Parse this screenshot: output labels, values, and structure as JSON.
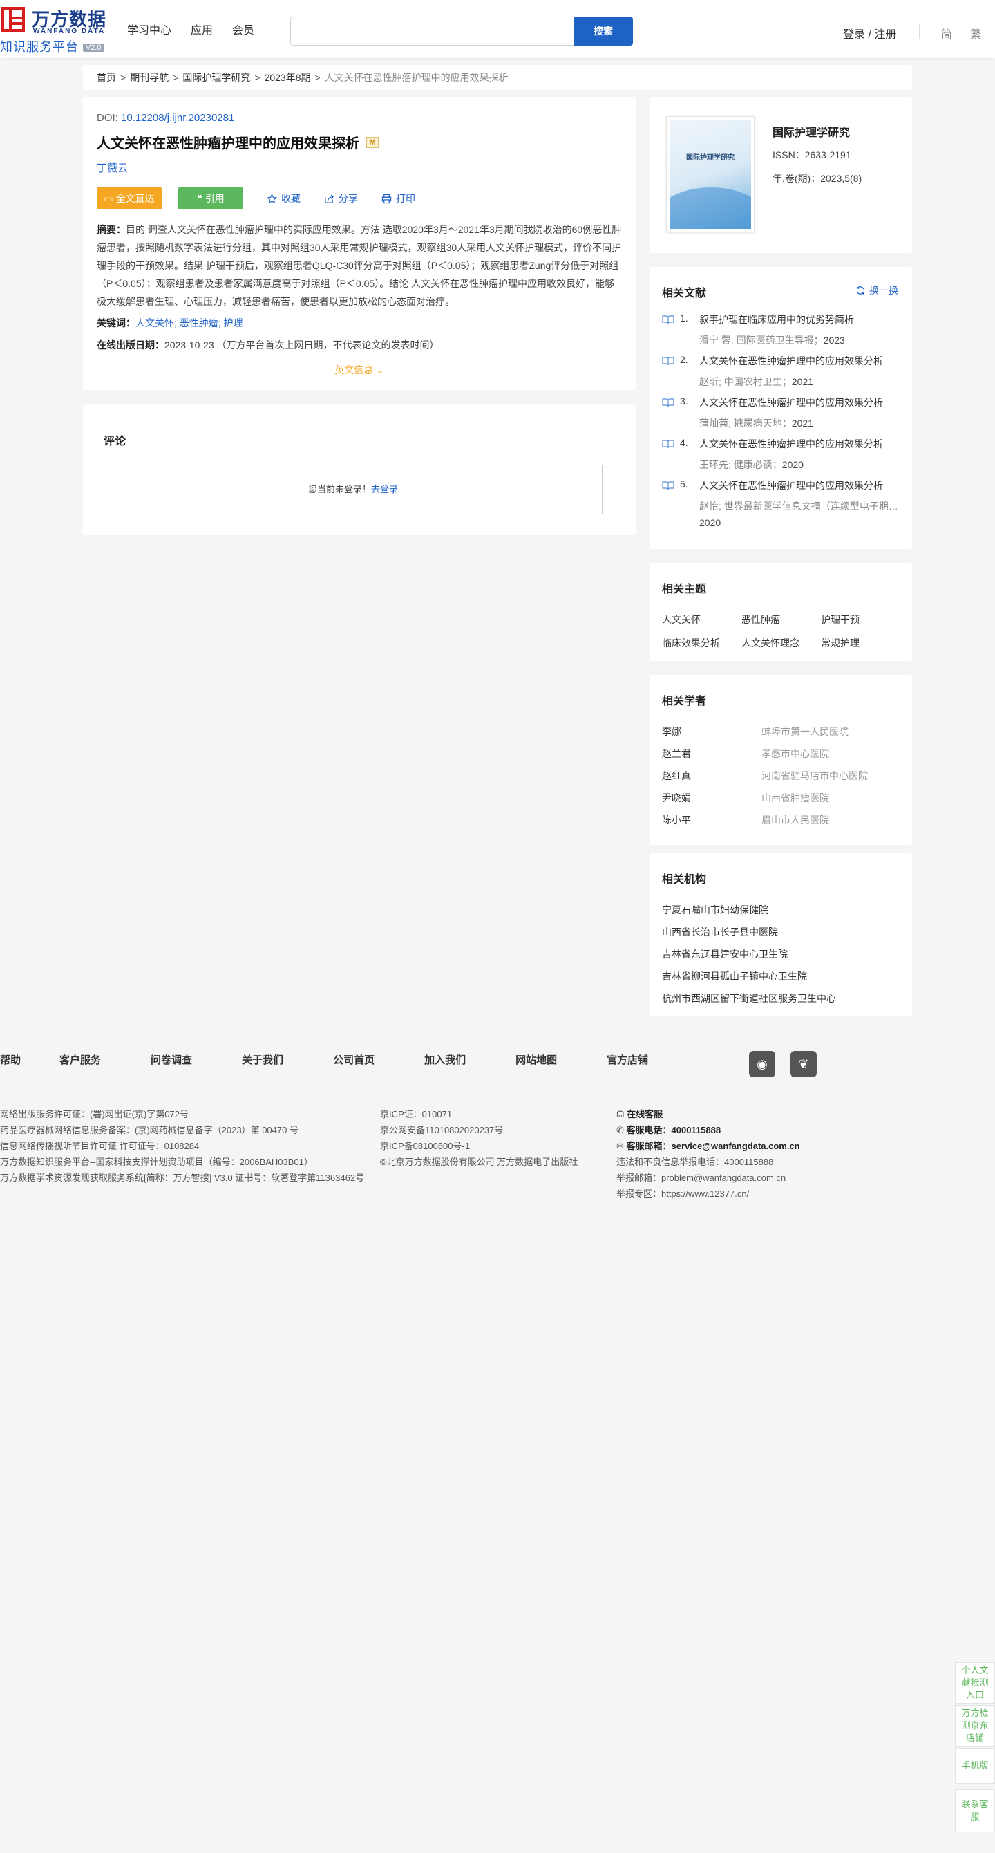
{
  "header": {
    "logo_cn": "万方数据",
    "logo_en": "WANFANG DATA",
    "logo_sub": "知识服务平台",
    "logo_version": "V2.0",
    "nav": [
      "学习中心",
      "应用",
      "会员"
    ],
    "search_placeholder": "",
    "search_button": "搜索",
    "login": "登录 / 注册",
    "lang_simplified": "简",
    "lang_traditional": "繁"
  },
  "breadcrumb": {
    "home": "首页",
    "journals": "期刊导航",
    "journal": "国际护理学研究",
    "issue": "2023年8期",
    "current": "人文关怀在恶性肿瘤护理中的应用效果探析"
  },
  "article": {
    "doi_label": "DOI:",
    "doi": "10.12208/j.ijnr.20230281",
    "title": "人文关怀在恶性肿瘤护理中的应用效果探析",
    "badge": "M",
    "author": "丁薇云",
    "btn_full": "全文直达",
    "btn_cite": "引用",
    "fav": "收藏",
    "share": "分享",
    "print": "打印",
    "abstract_label": "摘要：",
    "abstract": "目的 调查人文关怀在恶性肿瘤护理中的实际应用效果。方法 选取2020年3月～2021年3月期间我院收治的60例恶性肿瘤患者，按照随机数字表法进行分组，其中对照组30人采用常规护理模式，观察组30人采用人文关怀护理模式，评价不同护理手段的干预效果。结果 护理干预后，观察组患者QLQ-C30评分高于对照组（P＜0.05）；观察组患者Zung评分低于对照组（P＜0.05）；观察组患者及患者家属满意度高于对照组（P＜0.05）。结论 人文关怀在恶性肿瘤护理中应用收效良好，能够极大缓解患者生理、心理压力，减轻患者痛苦，使患者以更加放松的心态面对治疗。",
    "keywords_label": "关键词：",
    "keywords": "人文关怀; 恶性肿瘤; 护理",
    "pubdate_label": "在线出版日期：",
    "pubdate": "2023-10-23",
    "pubdate_note": "（万方平台首次上网日期，不代表论文的发表时间）",
    "en_info": "英文信息"
  },
  "comments": {
    "title": "评论",
    "prompt": "您当前未登录！",
    "login_link": "去登录"
  },
  "journal": {
    "cover_text": "国际护理学研究",
    "name": "国际护理学研究",
    "issn": "ISSN：2633-2191",
    "volume": "年,卷(期)：2023,5(8)"
  },
  "related": {
    "title": "相关文献",
    "refresh": "换一换",
    "items": [
      {
        "num": "1.",
        "title": "叙事护理在临床应用中的优劣势简析",
        "meta": "潘宁  蓉; 国际医药卫生导报；",
        "year": "2023"
      },
      {
        "num": "2.",
        "title": "人文关怀在恶性肿瘤护理中的应用效果分析",
        "meta": "赵昕; 中国农村卫生；",
        "year": "2021"
      },
      {
        "num": "3.",
        "title": "人文关怀在恶性肿瘤护理中的应用效果分析",
        "meta": "蒲灿菊; 糖尿病天地；",
        "year": "2021"
      },
      {
        "num": "4.",
        "title": "人文关怀在恶性肿瘤护理中的应用效果分析",
        "meta": "王环先; 健康必读；",
        "year": "2020"
      },
      {
        "num": "5.",
        "title": "人文关怀在恶性肿瘤护理中的应用效果分析",
        "meta": "赵怡; 世界最新医学信息文摘（连续型电子期刊）；",
        "year": "2020"
      }
    ]
  },
  "topics": {
    "title": "相关主题",
    "items": [
      "人文关怀",
      "恶性肿瘤",
      "护理干预",
      "临床效果分析",
      "人文关怀理念",
      "常规护理"
    ]
  },
  "scholars": {
    "title": "相关学者",
    "items": [
      {
        "name": "李娜",
        "org": "蚌埠市第一人民医院"
      },
      {
        "name": "赵兰君",
        "org": "孝感市中心医院"
      },
      {
        "name": "赵红真",
        "org": "河南省驻马店市中心医院"
      },
      {
        "name": "尹晓娟",
        "org": "山西省肿瘤医院"
      },
      {
        "name": "陈小平",
        "org": "眉山市人民医院"
      }
    ]
  },
  "orgs": {
    "title": "相关机构",
    "items": [
      "宁夏石嘴山市妇幼保健院",
      "山西省长治市长子县中医院",
      "吉林省东辽县建安中心卫生院",
      "吉林省柳河县孤山子镇中心卫生院",
      "杭州市西湖区留下街道社区服务卫生中心"
    ]
  },
  "footer": {
    "nav": [
      "帮助",
      "客户服务",
      "问卷调查",
      "关于我们",
      "公司首页",
      "加入我们",
      "网站地图",
      "官方店铺"
    ],
    "col1": [
      "网络出版服务许可证：(署)网出证(京)字第072号",
      "药品医疗器械网络信息服务备案：(京)网药械信息备字（2023）第 00470 号",
      "信息网络传播视听节目许可证 许可证号：0108284",
      "万方数据知识服务平台--国家科技支撑计划资助项目（编号：2006BAH03B01）",
      "万方数据学术资源发现获取服务系统[简称：万方智搜] V3.0 证书号：软著登字第11363462号"
    ],
    "col2": [
      "京ICP证：010071",
      "京公网安备11010802020237号",
      "京ICP备08100800号-1",
      "©北京万方数据股份有限公司 万方数据电子出版社"
    ],
    "online_service": "在线客服",
    "phone_label": "客服电话：",
    "phone": "4000115888",
    "email_label": "客服邮箱：",
    "email": "service@wanfangdata.com.cn",
    "report_phone": "违法和不良信息举报电话：4000115888",
    "report_email": "举报邮箱：problem@wanfangdata.com.cn",
    "report_zone": "举报专区：https://www.12377.cn/"
  },
  "float": {
    "item1": "个人文献检测入口",
    "item2": "万方检测京东店铺",
    "item3": "手机版",
    "item4": "联系客服"
  }
}
